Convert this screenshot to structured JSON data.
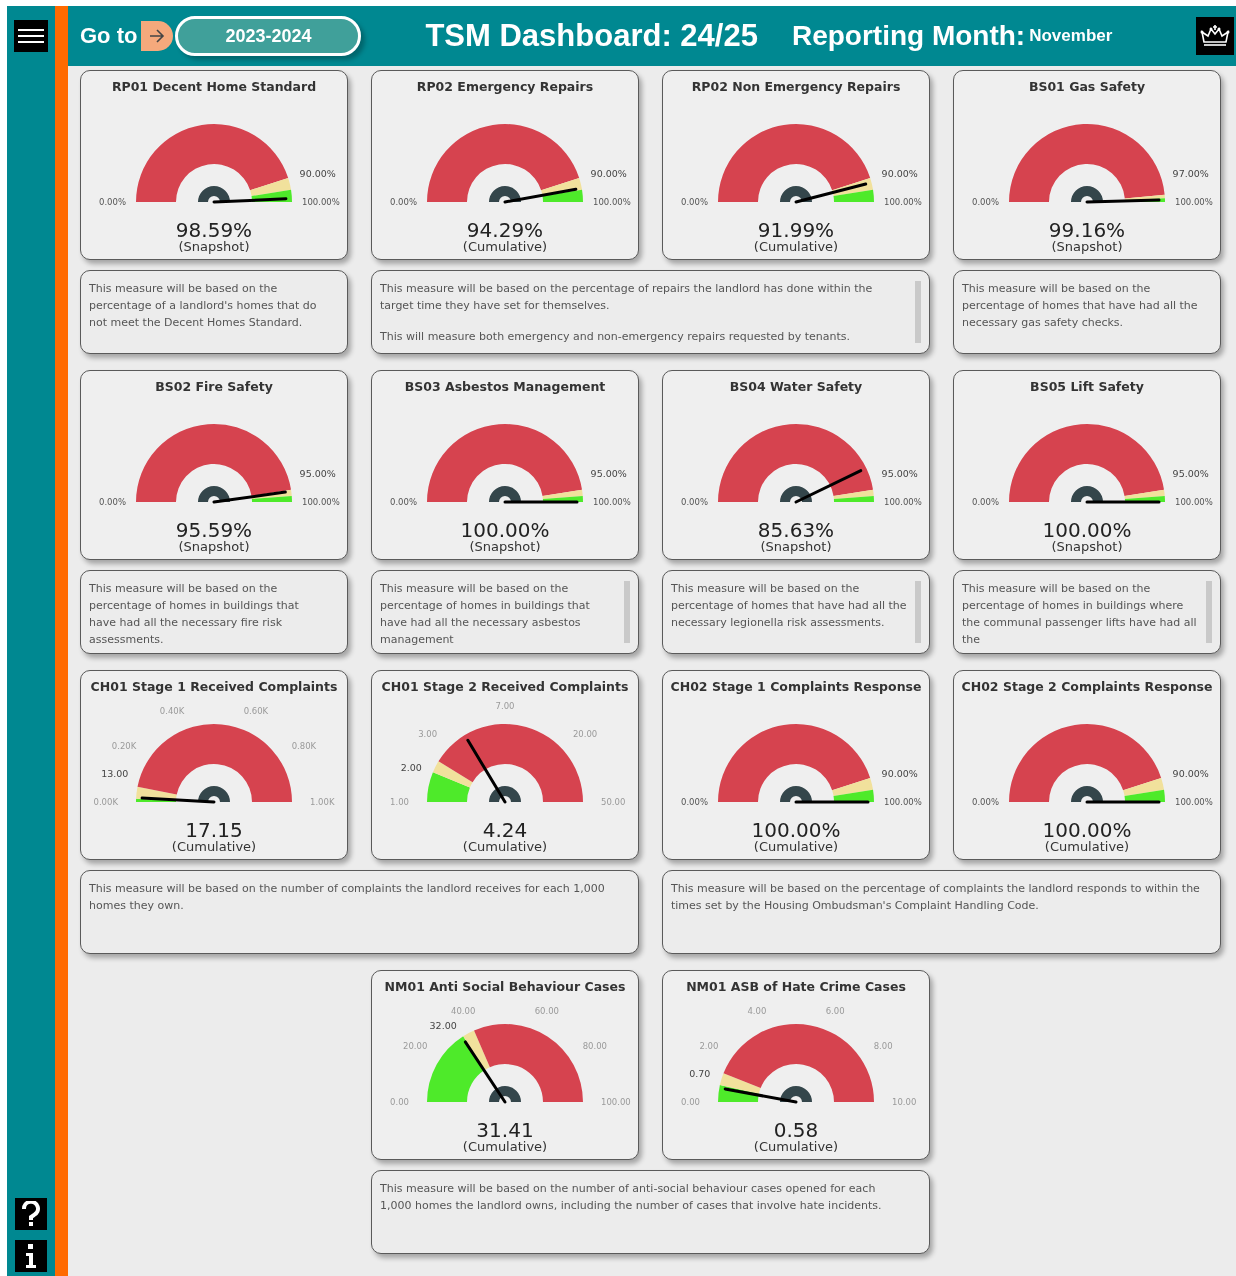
{
  "header": {
    "go_to_label": "Go to",
    "year_button": "2023-2024",
    "title": "TSM Dashboard: 24/25",
    "month_label": "Reporting Month:",
    "month": "November"
  },
  "sections": [
    {
      "groups": [
        {
          "gauges": [
            {
              "title": "RP01 Decent Home Standard",
              "value": "98.59%",
              "basis": "(Snapshot)",
              "bands": [
                {
                  "color": "#d6434f"
                },
                {
                  "color": "#f1e19c"
                },
                {
                  "color": "#4eea2a"
                }
              ],
              "labels": [
                {
                  "kind": "end",
                  "text": "0.00%"
                },
                {
                  "kind": "target",
                  "text": "90.00%"
                },
                {
                  "kind": "end",
                  "text": "100.00%"
                }
              ]
            }
          ],
          "description": {
            "scrollbar": false,
            "paragraphs": [
              "This measure will be based on the percentage of a landlord's homes that do not meet the Decent Homes Standard."
            ]
          }
        },
        {
          "gauges": [
            {
              "title": "RP02 Emergency Repairs",
              "value": "94.29%",
              "basis": "(Cumulative)",
              "bands": [
                {
                  "color": "#d6434f"
                },
                {
                  "color": "#f1e19c"
                },
                {
                  "color": "#4eea2a"
                }
              ],
              "labels": [
                {
                  "kind": "end",
                  "text": "0.00%"
                },
                {
                  "kind": "target",
                  "text": "90.00%"
                },
                {
                  "kind": "end",
                  "text": "100.00%"
                }
              ]
            },
            {
              "title": "RP02 Non Emergency Repairs",
              "value": "91.99%",
              "basis": "(Cumulative)",
              "bands": [
                {
                  "color": "#d6434f"
                },
                {
                  "color": "#f1e19c"
                },
                {
                  "color": "#4eea2a"
                }
              ],
              "labels": [
                {
                  "kind": "end",
                  "text": "0.00%"
                },
                {
                  "kind": "target",
                  "text": "90.00%"
                },
                {
                  "kind": "end",
                  "text": "100.00%"
                }
              ]
            }
          ],
          "description": {
            "scrollbar": true,
            "paragraphs": [
              "This measure will be based on the percentage of repairs the landlord has done within the target time they have set for themselves.",
              "This will measure both emergency and non-emergency repairs requested by tenants."
            ]
          }
        },
        {
          "gauges": [
            {
              "title": "BS01 Gas Safety",
              "value": "99.16%",
              "basis": "(Snapshot)",
              "bands": [
                {
                  "color": "#d6434f"
                },
                {
                  "color": "#f1e19c"
                },
                {
                  "color": "#4eea2a"
                }
              ],
              "labels": [
                {
                  "kind": "end",
                  "text": "0.00%"
                },
                {
                  "kind": "target",
                  "text": "97.00%"
                },
                {
                  "kind": "end",
                  "text": "100.00%"
                }
              ]
            }
          ],
          "description": {
            "scrollbar": false,
            "paragraphs": [
              "This measure will be based on the percentage of homes that have had all the necessary gas safety checks."
            ]
          }
        }
      ]
    },
    {
      "groups": [
        {
          "gauges": [
            {
              "title": "BS02 Fire Safety",
              "value": "95.59%",
              "basis": "(Snapshot)",
              "bands": [
                {
                  "color": "#d6434f"
                },
                {
                  "color": "#f1e19c"
                },
                {
                  "color": "#4eea2a"
                }
              ],
              "labels": [
                {
                  "kind": "end",
                  "text": "0.00%"
                },
                {
                  "kind": "target",
                  "text": "95.00%"
                },
                {
                  "kind": "end",
                  "text": "100.00%"
                }
              ]
            }
          ],
          "description": {
            "scrollbar": false,
            "paragraphs": [
              "This measure will be based on the percentage of homes in buildings that have had all the necessary fire risk assessments."
            ]
          }
        },
        {
          "gauges": [
            {
              "title": "BS03 Asbestos Management",
              "value": "100.00%",
              "basis": "(Snapshot)",
              "bands": [
                {
                  "color": "#d6434f"
                },
                {
                  "color": "#f1e19c"
                },
                {
                  "color": "#4eea2a"
                }
              ],
              "labels": [
                {
                  "kind": "end",
                  "text": "0.00%"
                },
                {
                  "kind": "target",
                  "text": "95.00%"
                },
                {
                  "kind": "end",
                  "text": "100.00%"
                }
              ]
            }
          ],
          "description": {
            "scrollbar": true,
            "paragraphs": [
              "This measure will be based on the percentage of homes in buildings that have had all the necessary asbestos management"
            ]
          }
        },
        {
          "gauges": [
            {
              "title": "BS04 Water Safety",
              "value": "85.63%",
              "basis": "(Snapshot)",
              "bands": [
                {
                  "color": "#d6434f"
                },
                {
                  "color": "#f1e19c"
                },
                {
                  "color": "#4eea2a"
                }
              ],
              "labels": [
                {
                  "kind": "end",
                  "text": "0.00%"
                },
                {
                  "kind": "target",
                  "text": "95.00%"
                },
                {
                  "kind": "end",
                  "text": "100.00%"
                }
              ]
            }
          ],
          "description": {
            "scrollbar": true,
            "paragraphs": [
              "This measure will be based on the percentage of homes that have had all the necessary legionella risk assessments."
            ]
          }
        },
        {
          "gauges": [
            {
              "title": "BS05 Lift Safety",
              "value": "100.00%",
              "basis": "(Snapshot)",
              "bands": [
                {
                  "color": "#d6434f"
                },
                {
                  "color": "#f1e19c"
                },
                {
                  "color": "#4eea2a"
                }
              ],
              "labels": [
                {
                  "kind": "end",
                  "text": "0.00%"
                },
                {
                  "kind": "target",
                  "text": "95.00%"
                },
                {
                  "kind": "end",
                  "text": "100.00%"
                }
              ]
            }
          ],
          "description": {
            "scrollbar": true,
            "paragraphs": [
              "This measure will be based on the percentage of homes in buildings where the communal passenger lifts have had all the"
            ]
          }
        }
      ]
    },
    {
      "groups": [
        {
          "gauges": [
            {
              "title": "CH01 Stage 1 Received Complaints",
              "value": "17.15",
              "basis": "(Cumulative)",
              "bands": [
                {
                  "color": "#4eea2a"
                },
                {
                  "color": "#f1e19c"
                },
                {
                  "color": "#d6434f"
                }
              ],
              "labels": [
                {
                  "kind": "tick",
                  "text": "0.00K"
                },
                {
                  "kind": "tick",
                  "text": "0.20K"
                },
                {
                  "kind": "tick",
                  "text": "0.40K"
                },
                {
                  "kind": "tick",
                  "text": "0.60K"
                },
                {
                  "kind": "tick",
                  "text": "0.80K"
                },
                {
                  "kind": "tick",
                  "text": "1.00K"
                },
                {
                  "kind": "target",
                  "text": "13.00"
                }
              ]
            },
            {
              "title": "CH01 Stage 2 Received Complaints",
              "value": "4.24",
              "basis": "(Cumulative)",
              "bands": [
                {
                  "color": "#4eea2a"
                },
                {
                  "color": "#f1e19c"
                },
                {
                  "color": "#d6434f"
                }
              ],
              "labels": [
                {
                  "kind": "tick",
                  "text": "1.00"
                },
                {
                  "kind": "tick",
                  "text": "3.00"
                },
                {
                  "kind": "tick",
                  "text": "7.00"
                },
                {
                  "kind": "tick",
                  "text": "20.00"
                },
                {
                  "kind": "tick",
                  "text": "50.00"
                },
                {
                  "kind": "target",
                  "text": "2.00"
                }
              ]
            }
          ],
          "description": {
            "scrollbar": false,
            "paragraphs": [
              "This measure will be based on the number of complaints the landlord receives for each 1,000 homes they own."
            ]
          }
        },
        {
          "gauges": [
            {
              "title": "CH02 Stage 1 Complaints Response",
              "value": "100.00%",
              "basis": "(Cumulative)",
              "bands": [
                {
                  "color": "#d6434f"
                },
                {
                  "color": "#f1e19c"
                },
                {
                  "color": "#4eea2a"
                }
              ],
              "labels": [
                {
                  "kind": "end",
                  "text": "0.00%"
                },
                {
                  "kind": "target",
                  "text": "90.00%"
                },
                {
                  "kind": "end",
                  "text": "100.00%"
                }
              ]
            },
            {
              "title": "CH02 Stage 2 Complaints Response",
              "value": "100.00%",
              "basis": "(Cumulative)",
              "bands": [
                {
                  "color": "#d6434f"
                },
                {
                  "color": "#f1e19c"
                },
                {
                  "color": "#4eea2a"
                }
              ],
              "labels": [
                {
                  "kind": "end",
                  "text": "0.00%"
                },
                {
                  "kind": "target",
                  "text": "90.00%"
                },
                {
                  "kind": "end",
                  "text": "100.00%"
                }
              ]
            }
          ],
          "description": {
            "scrollbar": false,
            "paragraphs": [
              "This measure will be based on the percentage of complaints the landlord responds to within the times set by the Housing Ombudsman's Complaint Handling Code."
            ]
          }
        }
      ]
    },
    {
      "groups": [
        {
          "gauges": [
            {
              "title": "NM01 Anti Social Behaviour Cases",
              "value": "31.41",
              "basis": "(Cumulative)",
              "bands": [
                {
                  "color": "#4eea2a"
                },
                {
                  "color": "#f1e19c"
                },
                {
                  "color": "#d6434f"
                }
              ],
              "labels": [
                {
                  "kind": "tick",
                  "text": "0.00"
                },
                {
                  "kind": "tick",
                  "text": "20.00"
                },
                {
                  "kind": "tick",
                  "text": "40.00"
                },
                {
                  "kind": "tick",
                  "text": "60.00"
                },
                {
                  "kind": "tick",
                  "text": "80.00"
                },
                {
                  "kind": "tick",
                  "text": "100.00"
                },
                {
                  "kind": "target",
                  "text": "32.00"
                }
              ]
            },
            {
              "title": "NM01 ASB of Hate Crime Cases",
              "value": "0.58",
              "basis": "(Cumulative)",
              "bands": [
                {
                  "color": "#4eea2a"
                },
                {
                  "color": "#f1e19c"
                },
                {
                  "color": "#d6434f"
                }
              ],
              "labels": [
                {
                  "kind": "tick",
                  "text": "0.00"
                },
                {
                  "kind": "tick",
                  "text": "2.00"
                },
                {
                  "kind": "tick",
                  "text": "4.00"
                },
                {
                  "kind": "tick",
                  "text": "6.00"
                },
                {
                  "kind": "tick",
                  "text": "8.00"
                },
                {
                  "kind": "tick",
                  "text": "10.00"
                },
                {
                  "kind": "target",
                  "text": "0.70"
                }
              ]
            }
          ],
          "description": {
            "scrollbar": false,
            "paragraphs": [
              "This measure will be based on the number of anti-social behaviour cases opened for each 1,000 homes the landlord owns, including the number of cases that involve hate incidents."
            ]
          }
        }
      ]
    }
  ]
}
